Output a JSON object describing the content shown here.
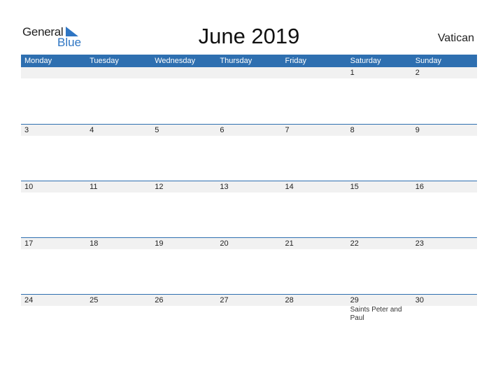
{
  "logo": {
    "line1": "General",
    "line2": "Blue"
  },
  "title": "June 2019",
  "country": "Vatican",
  "colors": {
    "accent": "#2e6fb0",
    "strip": "#f1f1f1"
  },
  "weekdays": [
    "Monday",
    "Tuesday",
    "Wednesday",
    "Thursday",
    "Friday",
    "Saturday",
    "Sunday"
  ],
  "weeks": [
    {
      "days": [
        "",
        "",
        "",
        "",
        "",
        "1",
        "2"
      ],
      "events": [
        "",
        "",
        "",
        "",
        "",
        "",
        ""
      ]
    },
    {
      "days": [
        "3",
        "4",
        "5",
        "6",
        "7",
        "8",
        "9"
      ],
      "events": [
        "",
        "",
        "",
        "",
        "",
        "",
        ""
      ]
    },
    {
      "days": [
        "10",
        "11",
        "12",
        "13",
        "14",
        "15",
        "16"
      ],
      "events": [
        "",
        "",
        "",
        "",
        "",
        "",
        ""
      ]
    },
    {
      "days": [
        "17",
        "18",
        "19",
        "20",
        "21",
        "22",
        "23"
      ],
      "events": [
        "",
        "",
        "",
        "",
        "",
        "",
        ""
      ]
    },
    {
      "days": [
        "24",
        "25",
        "26",
        "27",
        "28",
        "29",
        "30"
      ],
      "events": [
        "",
        "",
        "",
        "",
        "",
        "Saints Peter and Paul",
        ""
      ]
    }
  ]
}
